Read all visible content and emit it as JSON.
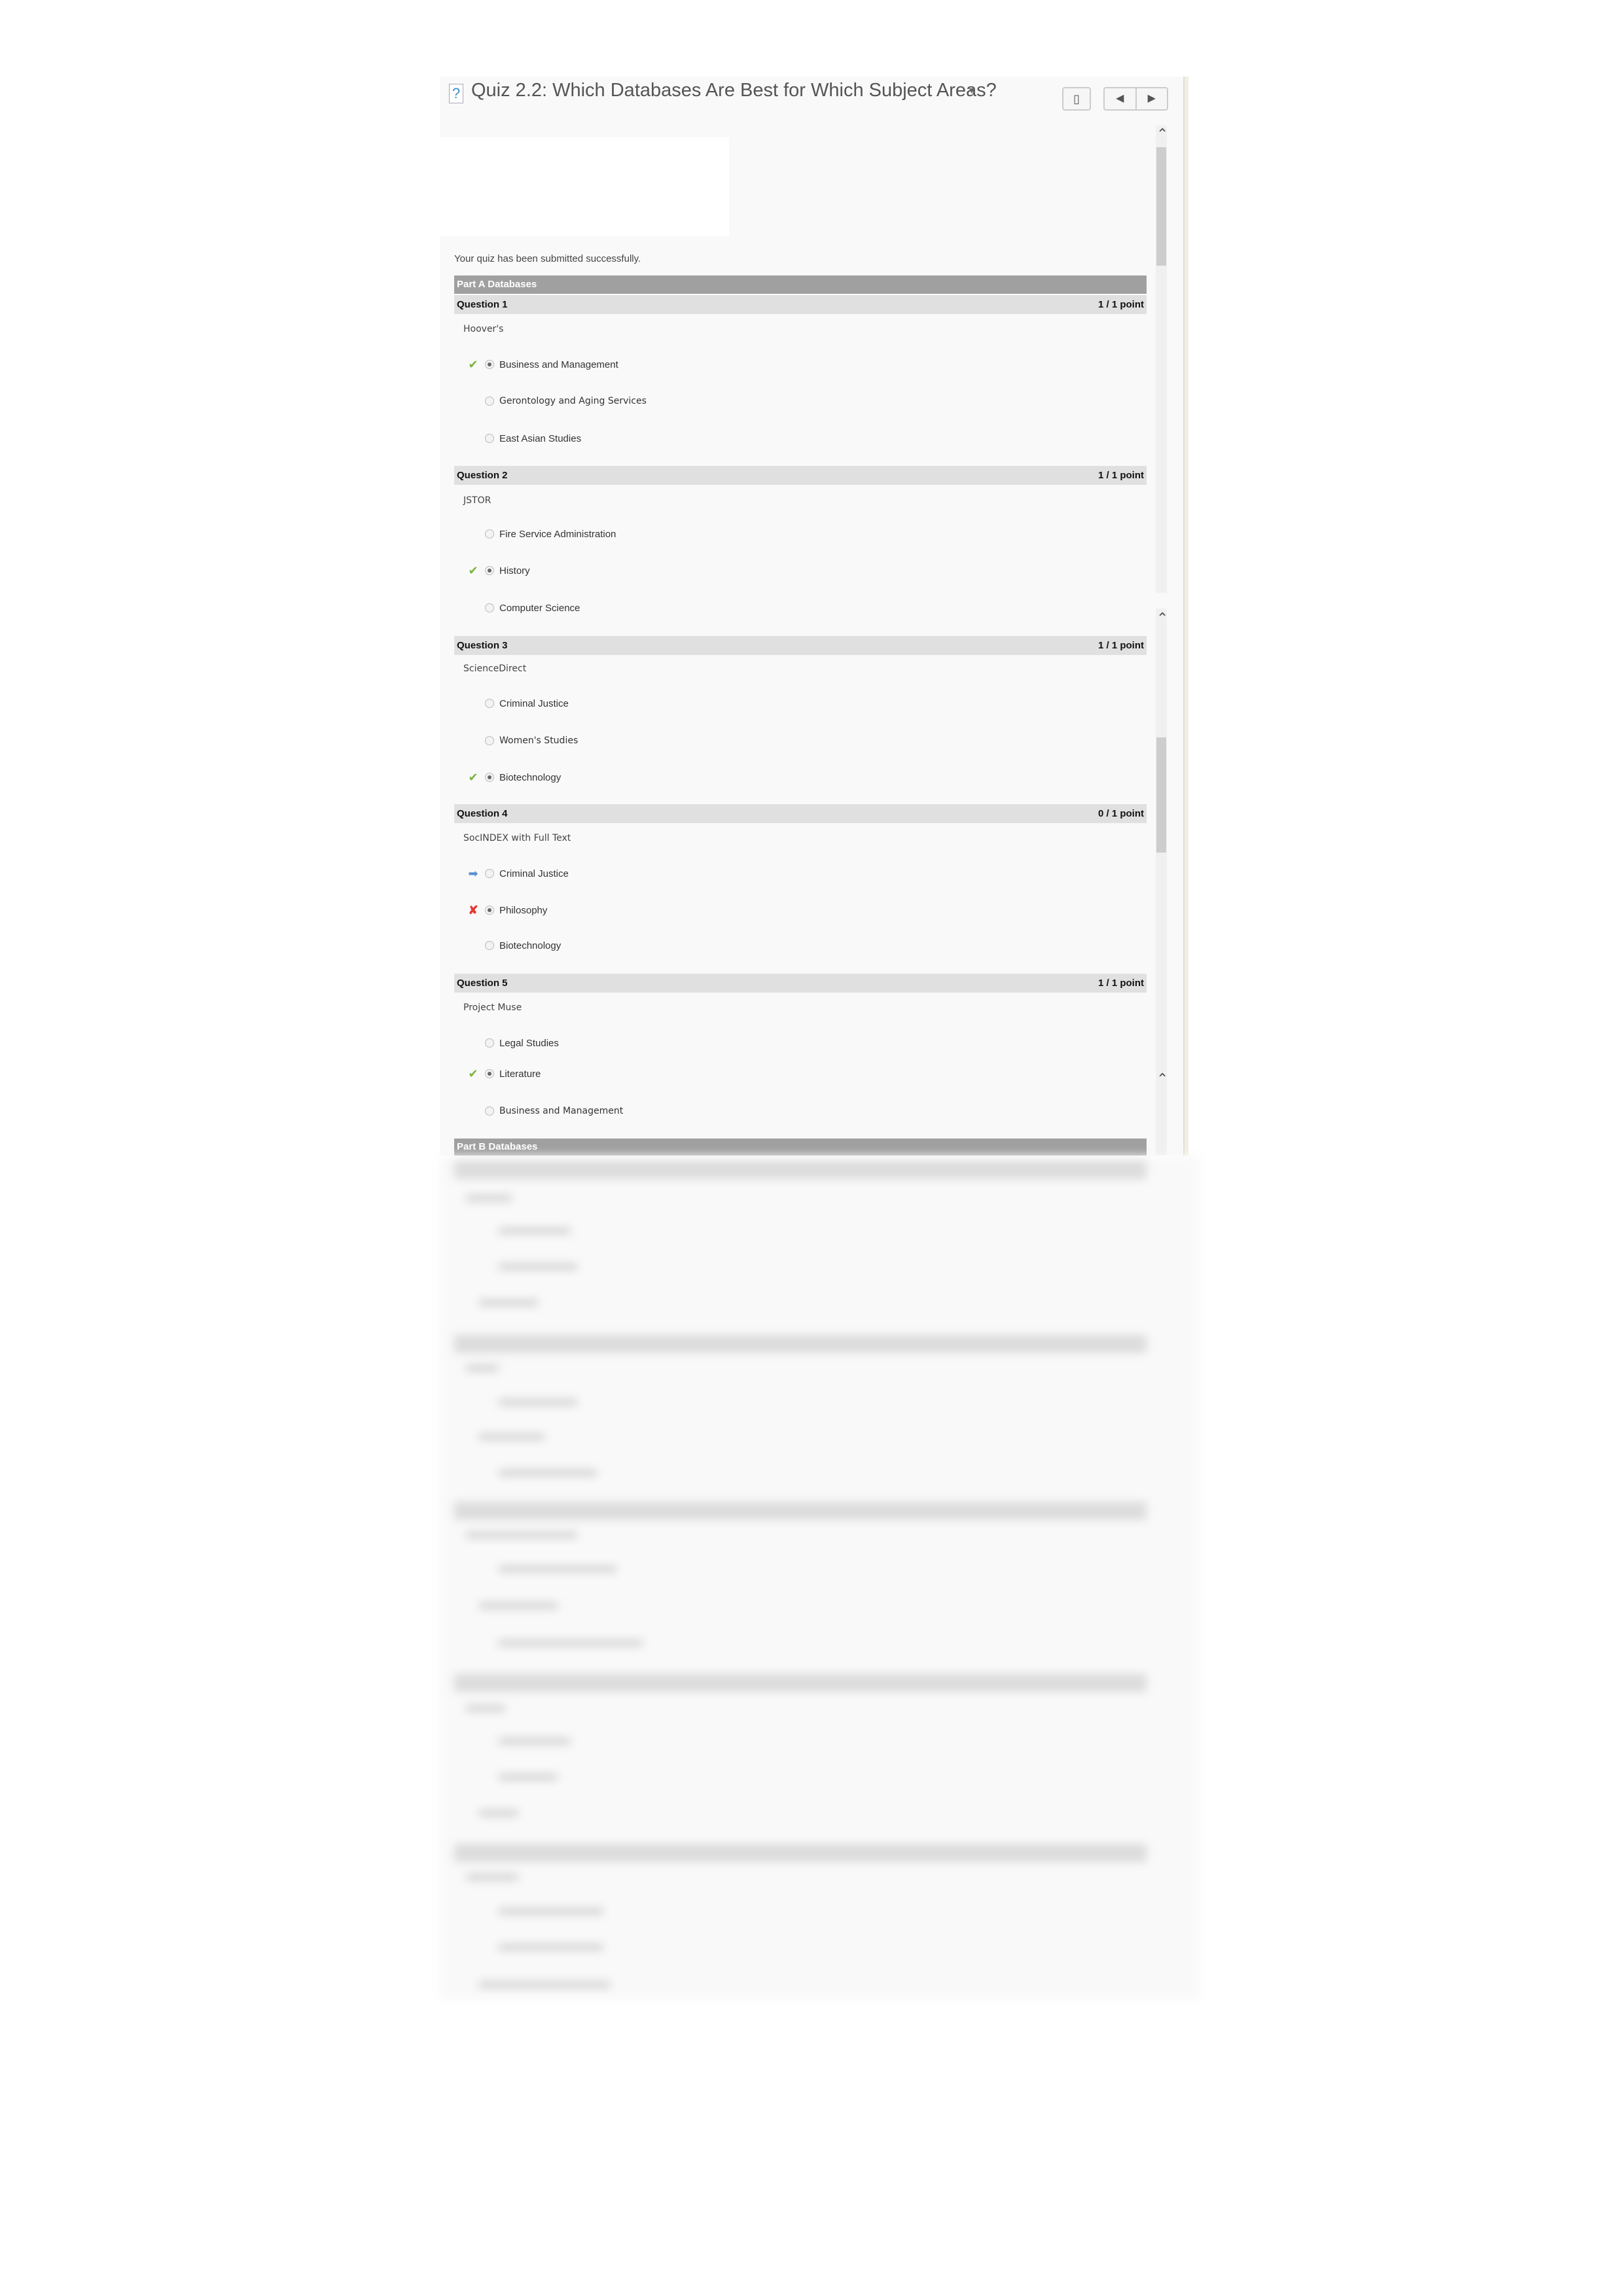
{
  "header": {
    "title": "Quiz 2.2: Which Databases Are Best for Which Subject Areas?",
    "icon": "quiz-question-icon",
    "bookmark_icon": "bookmark-icon",
    "prev_icon": "previous-arrow-icon",
    "next_icon": "next-arrow-icon"
  },
  "status": "Your quiz has been submitted successfully.",
  "colors": {
    "correct": "#7cb342",
    "incorrect": "#e53935",
    "answer_pointer": "#5b8fd6",
    "section_bar": "#a0a0a0",
    "question_bar": "#e0e0e0"
  },
  "sections": [
    {
      "title": "Part A Databases",
      "questions": [
        {
          "label": "Question 1",
          "score": "1 / 1 point",
          "prompt": "Hoover's",
          "options": [
            {
              "label": "Business and Management",
              "selected": true,
              "mark": "correct"
            },
            {
              "label": "Gerontology and Aging Services",
              "selected": false,
              "mark": ""
            },
            {
              "label": "East Asian Studies",
              "selected": false,
              "mark": ""
            }
          ]
        },
        {
          "label": "Question 2",
          "score": "1 / 1 point",
          "prompt": "JSTOR",
          "options": [
            {
              "label": "Fire Service Administration",
              "selected": false,
              "mark": ""
            },
            {
              "label": "History",
              "selected": true,
              "mark": "correct"
            },
            {
              "label": "Computer Science",
              "selected": false,
              "mark": ""
            }
          ]
        },
        {
          "label": "Question 3",
          "score": "1 / 1 point",
          "prompt": "ScienceDirect",
          "options": [
            {
              "label": "Criminal Justice",
              "selected": false,
              "mark": ""
            },
            {
              "label": "Women's Studies",
              "selected": false,
              "mark": ""
            },
            {
              "label": "Biotechnology",
              "selected": true,
              "mark": "correct"
            }
          ]
        },
        {
          "label": "Question 4",
          "score": "0 / 1 point",
          "prompt": "SocINDEX with Full Text",
          "options": [
            {
              "label": "Criminal Justice",
              "selected": false,
              "mark": "correct-answer-pointer"
            },
            {
              "label": "Philosophy",
              "selected": true,
              "mark": "incorrect"
            },
            {
              "label": "Biotechnology",
              "selected": false,
              "mark": ""
            }
          ]
        },
        {
          "label": "Question 5",
          "score": "1 / 1 point",
          "prompt": "Project Muse",
          "options": [
            {
              "label": "Legal Studies",
              "selected": false,
              "mark": ""
            },
            {
              "label": "Literature",
              "selected": true,
              "mark": "correct"
            },
            {
              "label": "Business and Management",
              "selected": false,
              "mark": ""
            }
          ]
        }
      ]
    },
    {
      "title": "Part B Databases"
    }
  ]
}
